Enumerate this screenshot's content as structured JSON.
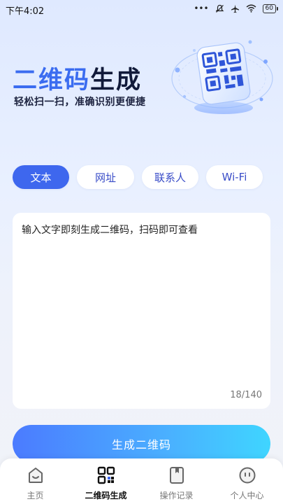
{
  "status_bar": {
    "time": "下午4:02",
    "dots": "•••",
    "battery": "60"
  },
  "hero": {
    "title_part1": "二维码",
    "title_part2": "生成",
    "subtitle": "轻松扫一扫，准确识别更便捷",
    "art_icon": "qr-code-icon"
  },
  "tabs": [
    {
      "label": "文本",
      "active": true
    },
    {
      "label": "网址",
      "active": false
    },
    {
      "label": "联系人",
      "active": false
    },
    {
      "label": "Wi-Fi",
      "active": false
    }
  ],
  "editor": {
    "value": "输入文字即刻生成二维码，扫码即可查看",
    "counter": "18/140"
  },
  "generate_button": {
    "label": "生成二维码"
  },
  "bottom_nav": [
    {
      "label": "主页",
      "icon": "home-icon",
      "active": false
    },
    {
      "label": "二维码生成",
      "icon": "qr-code-icon",
      "active": true
    },
    {
      "label": "操作记录",
      "icon": "history-icon",
      "active": false
    },
    {
      "label": "个人中心",
      "icon": "profile-icon",
      "active": false
    }
  ],
  "colors": {
    "accent": "#3e67ee",
    "title_blue": "#3b6cf0",
    "button_gradient_start": "#4b7bff",
    "button_gradient_end": "#3fd5ff"
  }
}
